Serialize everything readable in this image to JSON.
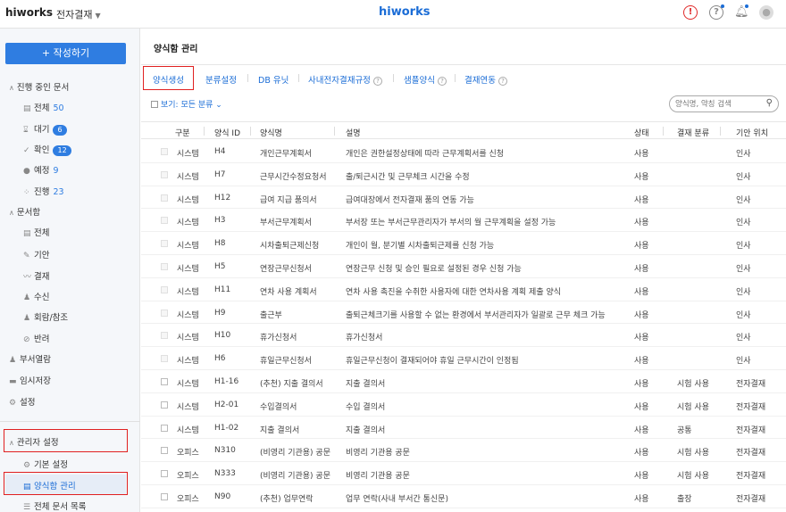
{
  "header": {
    "logo": "hiworks",
    "app_name": "전자결재",
    "brand": "hiworks",
    "icons": [
      "alert-icon",
      "help-icon",
      "bell-icon",
      "avatar-icon"
    ]
  },
  "sidebar": {
    "write_button": "+ 작성하기",
    "in_progress": {
      "title": "진행 중인 문서",
      "items": [
        {
          "label": "전체",
          "count": "50"
        },
        {
          "label": "대기",
          "count": "6"
        },
        {
          "label": "확인",
          "count": "12"
        },
        {
          "label": "예정",
          "count": "9"
        },
        {
          "label": "진행",
          "count": "23"
        }
      ]
    },
    "docbox": {
      "title": "문서함",
      "items": [
        {
          "label": "전체"
        },
        {
          "label": "기안"
        },
        {
          "label": "결재"
        },
        {
          "label": "수신"
        },
        {
          "label": "회람/참조"
        },
        {
          "label": "반려"
        }
      ]
    },
    "dept_view": "부서열람",
    "temp_save": "임시저장",
    "settings": "설정",
    "admin": {
      "title": "관리자 설정",
      "items": [
        {
          "label": "기본 설정"
        },
        {
          "label": "양식함 관리"
        },
        {
          "label": "전체 문서 목록"
        }
      ]
    }
  },
  "main": {
    "title": "양식함 관리",
    "tabs": [
      {
        "label": "양식생성"
      },
      {
        "label": "분류설정"
      },
      {
        "label": "DB 유닛"
      },
      {
        "label": "사내전자결재규정"
      },
      {
        "label": "샘플양식"
      },
      {
        "label": "결재연동"
      }
    ],
    "view_filter": "보기: 모든 분류",
    "search_placeholder": "양식명, 약칭 검색",
    "columns": [
      "구분",
      "양식 ID",
      "양식명",
      "설명",
      "상태",
      "결재 분류",
      "기안 위치"
    ],
    "rows": [
      {
        "type": "시스템",
        "id": "H4",
        "name": "개인근무계획서",
        "desc": "개인은 권한설정상태에 따라 근무계획서를 신청",
        "status": "사용",
        "category": "",
        "location": "인사",
        "disabled": true
      },
      {
        "type": "시스템",
        "id": "H7",
        "name": "근무시간수정요청서",
        "desc": "출/퇴근시간 및 근무체크 시간을 수정",
        "status": "사용",
        "category": "",
        "location": "인사",
        "disabled": true
      },
      {
        "type": "시스템",
        "id": "H12",
        "name": "급여 지급 품의서",
        "desc": "급여대장에서 전자결재 품의 연동 가능",
        "status": "사용",
        "category": "",
        "location": "인사",
        "disabled": true
      },
      {
        "type": "시스템",
        "id": "H3",
        "name": "부서근무계획서",
        "desc": "부서장 또는 부서근무관리자가 부서의 월 근무계획을 설정 가능",
        "status": "사용",
        "category": "",
        "location": "인사",
        "disabled": true
      },
      {
        "type": "시스템",
        "id": "H8",
        "name": "시차출퇴근제신청",
        "desc": "개인이 월, 분기별 시차출퇴근제를 신청 가능",
        "status": "사용",
        "category": "",
        "location": "인사",
        "disabled": true
      },
      {
        "type": "시스템",
        "id": "H5",
        "name": "연장근무신청서",
        "desc": "연장근무 신청 및 승인 필요로 설정된 경우 신청 가능",
        "status": "사용",
        "category": "",
        "location": "인사",
        "disabled": true
      },
      {
        "type": "시스템",
        "id": "H11",
        "name": "연차 사용 계획서",
        "desc": "연차 사용 촉진을 수취한 사용자에 대한 연차사용 계획 제출 양식",
        "status": "사용",
        "category": "",
        "location": "인사",
        "disabled": true
      },
      {
        "type": "시스템",
        "id": "H9",
        "name": "출근부",
        "desc": "출퇴근체크기를 사용할 수 없는 환경에서 부서관리자가 일괄로 근무 체크 가능",
        "status": "사용",
        "category": "",
        "location": "인사",
        "disabled": true
      },
      {
        "type": "시스템",
        "id": "H10",
        "name": "휴가신청서",
        "desc": "휴가신청서",
        "status": "사용",
        "category": "",
        "location": "인사",
        "disabled": true
      },
      {
        "type": "시스템",
        "id": "H6",
        "name": "휴일근무신청서",
        "desc": "휴일근무신청이 결재되어야 휴일 근무시간이 인정됨",
        "status": "사용",
        "category": "",
        "location": "인사",
        "disabled": true
      },
      {
        "type": "시스템",
        "id": "H1-16",
        "name": "(추천) 지출 결의서",
        "desc": "지출 결의서",
        "status": "사용",
        "category": "시험 사용",
        "location": "전자결재",
        "disabled": false
      },
      {
        "type": "시스템",
        "id": "H2-01",
        "name": "수입결의서",
        "desc": "수입 결의서",
        "status": "사용",
        "category": "시험 사용",
        "location": "전자결재",
        "disabled": false
      },
      {
        "type": "시스템",
        "id": "H1-02",
        "name": "지출 결의서",
        "desc": "지출 결의서",
        "status": "사용",
        "category": "공통",
        "location": "전자결재",
        "disabled": false
      },
      {
        "type": "오피스",
        "id": "N310",
        "name": "(비영리 기관용) 공문",
        "desc": "비영리 기관용 공문",
        "status": "사용",
        "category": "시험 사용",
        "location": "전자결재",
        "disabled": false
      },
      {
        "type": "오피스",
        "id": "N333",
        "name": "(비영리 기관용) 공문",
        "desc": "비영리 기관용 공문",
        "status": "사용",
        "category": "시험 사용",
        "location": "전자결재",
        "disabled": false
      },
      {
        "type": "오피스",
        "id": "N90",
        "name": "(추천) 업무연락",
        "desc": "업무 연락(사내 부서간 통신문)",
        "status": "사용",
        "category": "출장",
        "location": "전자결재",
        "disabled": false
      }
    ]
  },
  "colors": {
    "accent": "#2f7de1",
    "link": "#1a6cd6",
    "highlight": "#e02020"
  }
}
